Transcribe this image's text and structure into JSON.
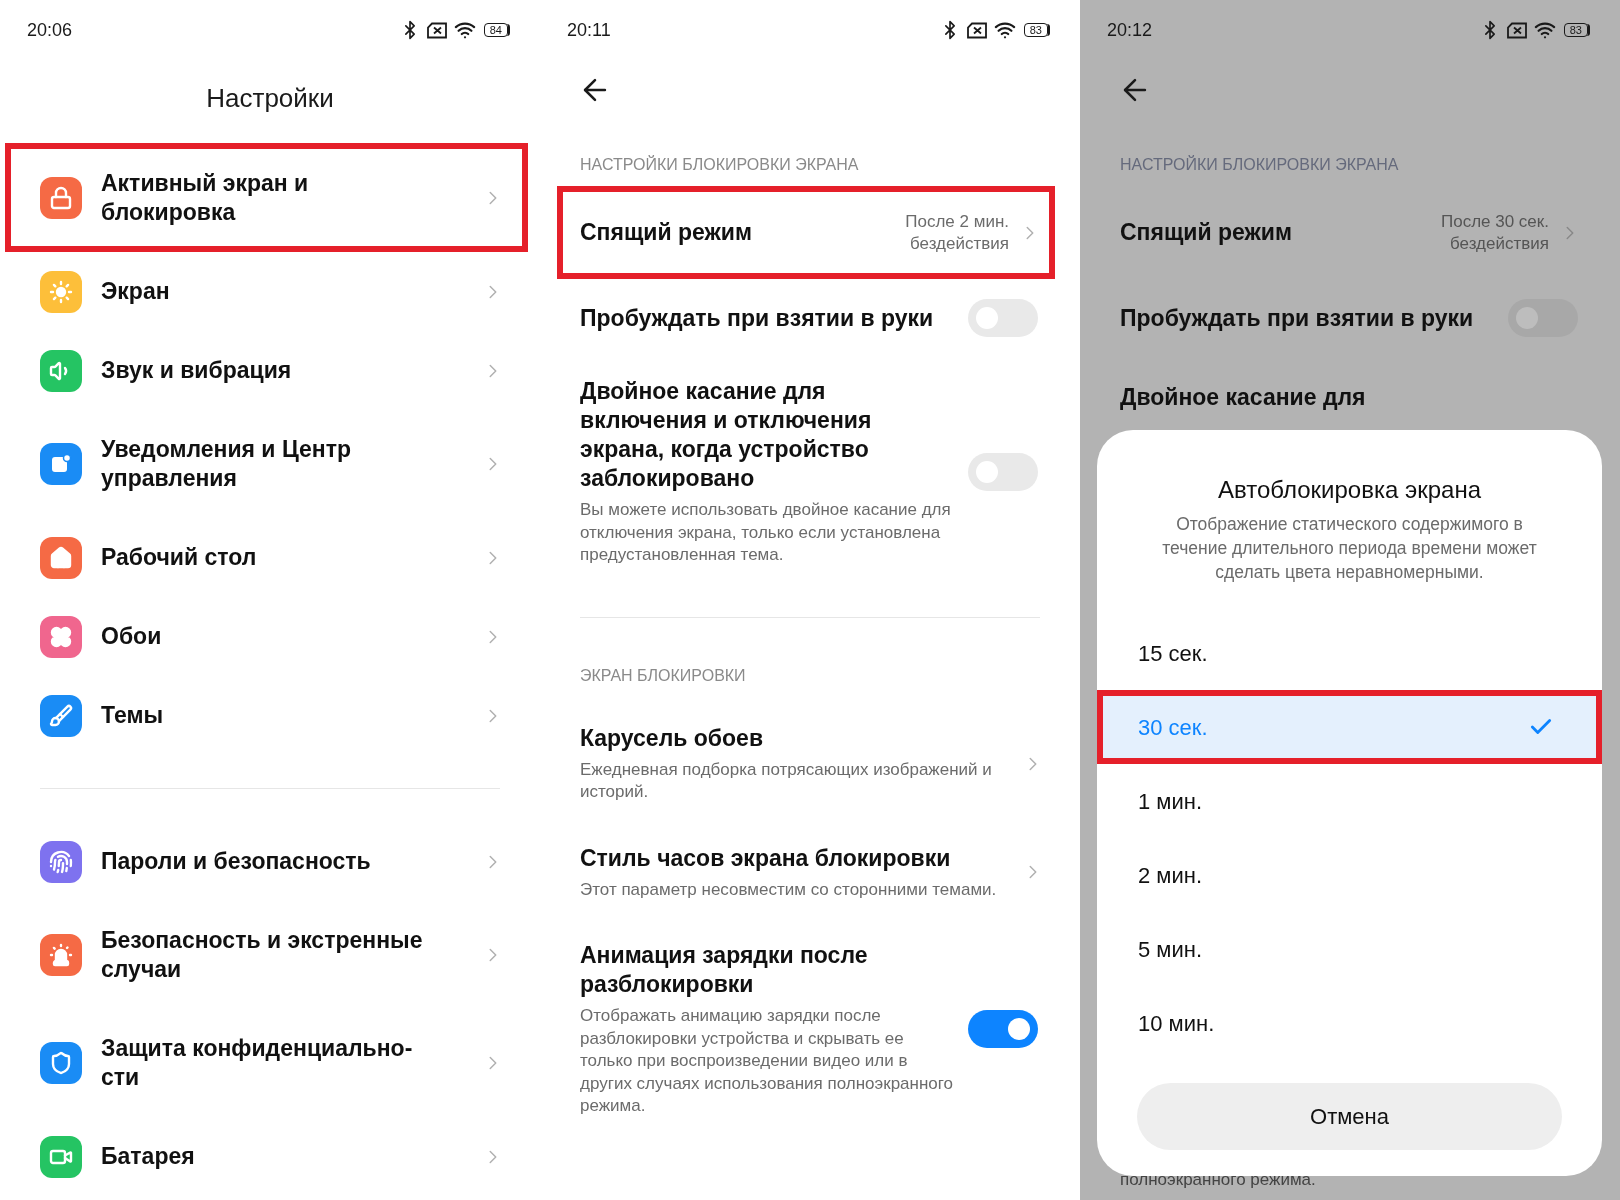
{
  "settings_screen": {
    "status_bar": {
      "time": "20:06",
      "battery": "84"
    },
    "title": "Настройки",
    "groups": [
      [
        {
          "label": "Активный экран и блокировка",
          "color": "#f56a45",
          "highlighted": true
        },
        {
          "label": "Экран",
          "color": "#fdbf3a",
          "highlighted": false
        },
        {
          "label": "Звук и вибрация",
          "color": "#25c463",
          "highlighted": false
        },
        {
          "label": "Уведомления и Центр управления",
          "color": "#1a8cf5",
          "highlighted": false
        },
        {
          "label": "Рабочий стол",
          "color": "#f56a45",
          "highlighted": false
        },
        {
          "label": "Обои",
          "color": "#f0668e",
          "highlighted": false
        },
        {
          "label": "Темы",
          "color": "#1a8cf5",
          "highlighted": false
        }
      ],
      [
        {
          "label": "Пароли и безопасность",
          "color": "#7e72ef",
          "highlighted": false
        },
        {
          "label": "Безопасность и экстренные случаи",
          "color": "#f56a45",
          "highlighted": false
        },
        {
          "label": "Защита конфиденциально-сти",
          "color": "#1a8cf5",
          "highlighted": false
        },
        {
          "label": "Батарея",
          "color": "#25c463",
          "highlighted": false
        }
      ]
    ]
  },
  "lock_screen_settings": {
    "status_bar": {
      "time": "20:11",
      "battery": "83"
    },
    "sections": [
      {
        "header": "НАСТРОЙКИ БЛОКИРОВКИ ЭКРАНА",
        "rows": [
          {
            "kind": "value",
            "title": "Спящий режим",
            "value": "После 2 мин. бездействия",
            "highlighted": true
          },
          {
            "kind": "toggle",
            "title": "Пробуждать при взятии в руки",
            "on": false
          },
          {
            "kind": "toggle",
            "title": "Двойное касание для включения и отключения экрана, когда устройство заблокировано",
            "description": "Вы можете использовать двойное касание для отключения экрана, только если установлена предустановленная тема.",
            "on": false
          }
        ]
      },
      {
        "header": "ЭКРАН БЛОКИРОВКИ",
        "rows": [
          {
            "kind": "link",
            "title": "Карусель обоев",
            "description": "Ежедневная подборка потрясающих изображений и историй."
          },
          {
            "kind": "link",
            "title": "Стиль часов экрана блокировки",
            "description": "Этот параметр несовместим со сторонними темами."
          },
          {
            "kind": "toggle",
            "title": "Анимация зарядки после разблокировки",
            "description": "Отображать анимацию зарядки после разблокировки устройства и скрывать ее только при воспроизведении видео или в других случаях использования полноэкранного режима.",
            "on": true
          }
        ]
      }
    ]
  },
  "lock_screen_dialog": {
    "status_bar": {
      "time": "20:12",
      "battery": "83"
    },
    "header": "НАСТРОЙКИ БЛОКИРОВКИ ЭКРАНА",
    "rows": [
      {
        "kind": "value",
        "title": "Спящий режим",
        "value": "После 30 сек. бездействия",
        "highlighted": false
      },
      {
        "kind": "toggle",
        "title": "Пробуждать при взятии в руки",
        "on": false
      },
      {
        "kind": "text",
        "title": "Двойное касание для"
      }
    ],
    "behind_text": "полноэкранного режима.",
    "dialog": {
      "title": "Автоблокировка экрана",
      "description": "Отображение статического содержимого в течение длительного периода времени может сделать цвета неравномерными.",
      "options": [
        {
          "label": "15 сек.",
          "selected": false,
          "highlighted": false
        },
        {
          "label": "30 сек.",
          "selected": true,
          "highlighted": true
        },
        {
          "label": "1 мин.",
          "selected": false,
          "highlighted": false
        },
        {
          "label": "2 мин.",
          "selected": false,
          "highlighted": false
        },
        {
          "label": "5 мин.",
          "selected": false,
          "highlighted": false
        },
        {
          "label": "10 мин.",
          "selected": false,
          "highlighted": false
        }
      ],
      "cancel": "Отмена"
    }
  }
}
